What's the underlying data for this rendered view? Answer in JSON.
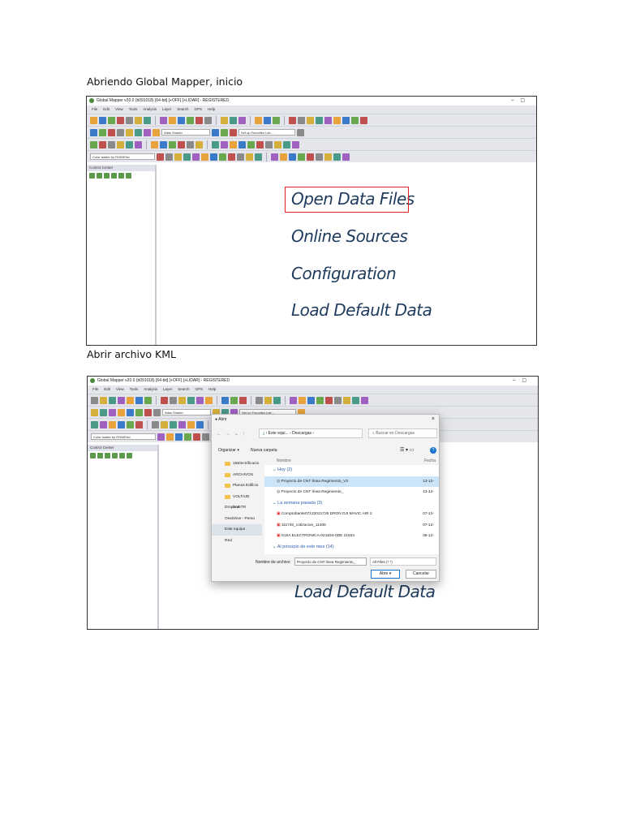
{
  "captions": {
    "first": "Abriendo Global Mapper, inicio",
    "second": "Abrir archivo KML"
  },
  "app": {
    "title1": "Global Mapper v20.0 (b091018) [64-bit] [+OFF] [+LIDAR] - REGISTERED",
    "title2": "Global Mapper v20.0 (b091018) [64-bit] [+OFF] [+LIDAR] - REGISTERED",
    "menu": [
      "File",
      "Edit",
      "View",
      "Tools",
      "Analysis",
      "Layer",
      "Search",
      "GPS",
      "Help"
    ],
    "shader": "Atlas Shader",
    "favorites": "Set up Favorites List...",
    "color_ladder": "Color ladder by RGB/Elev",
    "control_center": "Control Center"
  },
  "start_links": [
    "Open Data Files",
    "Online Sources",
    "Configuration",
    "Load Default Data"
  ],
  "dialog": {
    "title": "Abrir",
    "path": [
      "Este equi...",
      "Descargas"
    ],
    "search_placeholder": "Buscar en Descargas",
    "organize": "Organizar ▾",
    "new_folder": "Nueva carpeta",
    "sidebar": [
      "15Electrificacio",
      "ARCHIVOS",
      "Planos Edificio",
      "VOLTAJE AUSTR",
      "Dropbox",
      "OneDrive - Perso",
      "Este equipo",
      "Red"
    ],
    "col_name": "Nombre",
    "col_date": "Fecha",
    "groups": [
      {
        "label": "Hoy (2)",
        "items": [
          {
            "name": "Proyecto de CNT línea Regimiento_V3",
            "date": "13-12-"
          },
          {
            "name": "Proyecto de CNT línea Regimiento_",
            "date": "13-12-"
          }
        ]
      },
      {
        "label": "La semana pasada (3)",
        "items": [
          {
            "name": "Comprobante07122021726 DRON DJI MAVIC AIR 2",
            "date": "07-12-"
          },
          {
            "name": "111740_cotizacion_11406",
            "date": "07-12-"
          },
          {
            "name": "GUIA ELECTRONICA-021834-0DE 21834",
            "date": "06-12-"
          }
        ]
      },
      {
        "label": "Al principio de este mes (14)",
        "items": []
      }
    ],
    "filename_label": "Nombre de archivo:",
    "filename": "Proyecto de CNT línea Regimiento_",
    "filter": "All Files (*.*)",
    "open": "Abre",
    "cancel": "Cancelar"
  }
}
